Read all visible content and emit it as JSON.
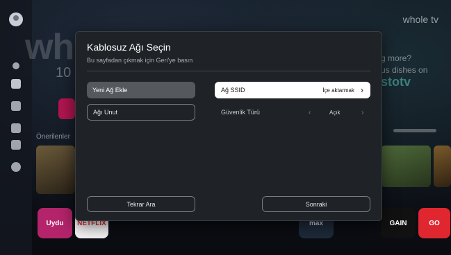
{
  "dialog": {
    "title": "Kablosuz Ağı Seçin",
    "subtitle": "Bu sayfadan çıkmak için Geri'ye basın",
    "add_network": "Yeni Ağ Ekle",
    "forget_network": "Ağı Unut",
    "ssid_label": "Ağ SSID",
    "ssid_value": "İçe aktarmak",
    "security_label": "Güvenlik Türü",
    "security_value": "Açık",
    "retry_label": "Tekrar Ara",
    "next_label": "Sonraki"
  },
  "background": {
    "brand": "whole tv",
    "hero_text": "whole tv",
    "hero_number": "10",
    "hero_right_1": "g more?",
    "hero_right_2": "us dishes on",
    "hero_right_3": "stotv",
    "recommendations_label": "Önerilenler",
    "apps": [
      "Uydu",
      "NETFLIX",
      "max",
      "GAIN",
      "GO"
    ]
  },
  "colors": {
    "dialog_bg": "#1f2226",
    "selected_button": "#55585d",
    "focus_white": "#ffffff",
    "accent_red": "#e0262f"
  }
}
